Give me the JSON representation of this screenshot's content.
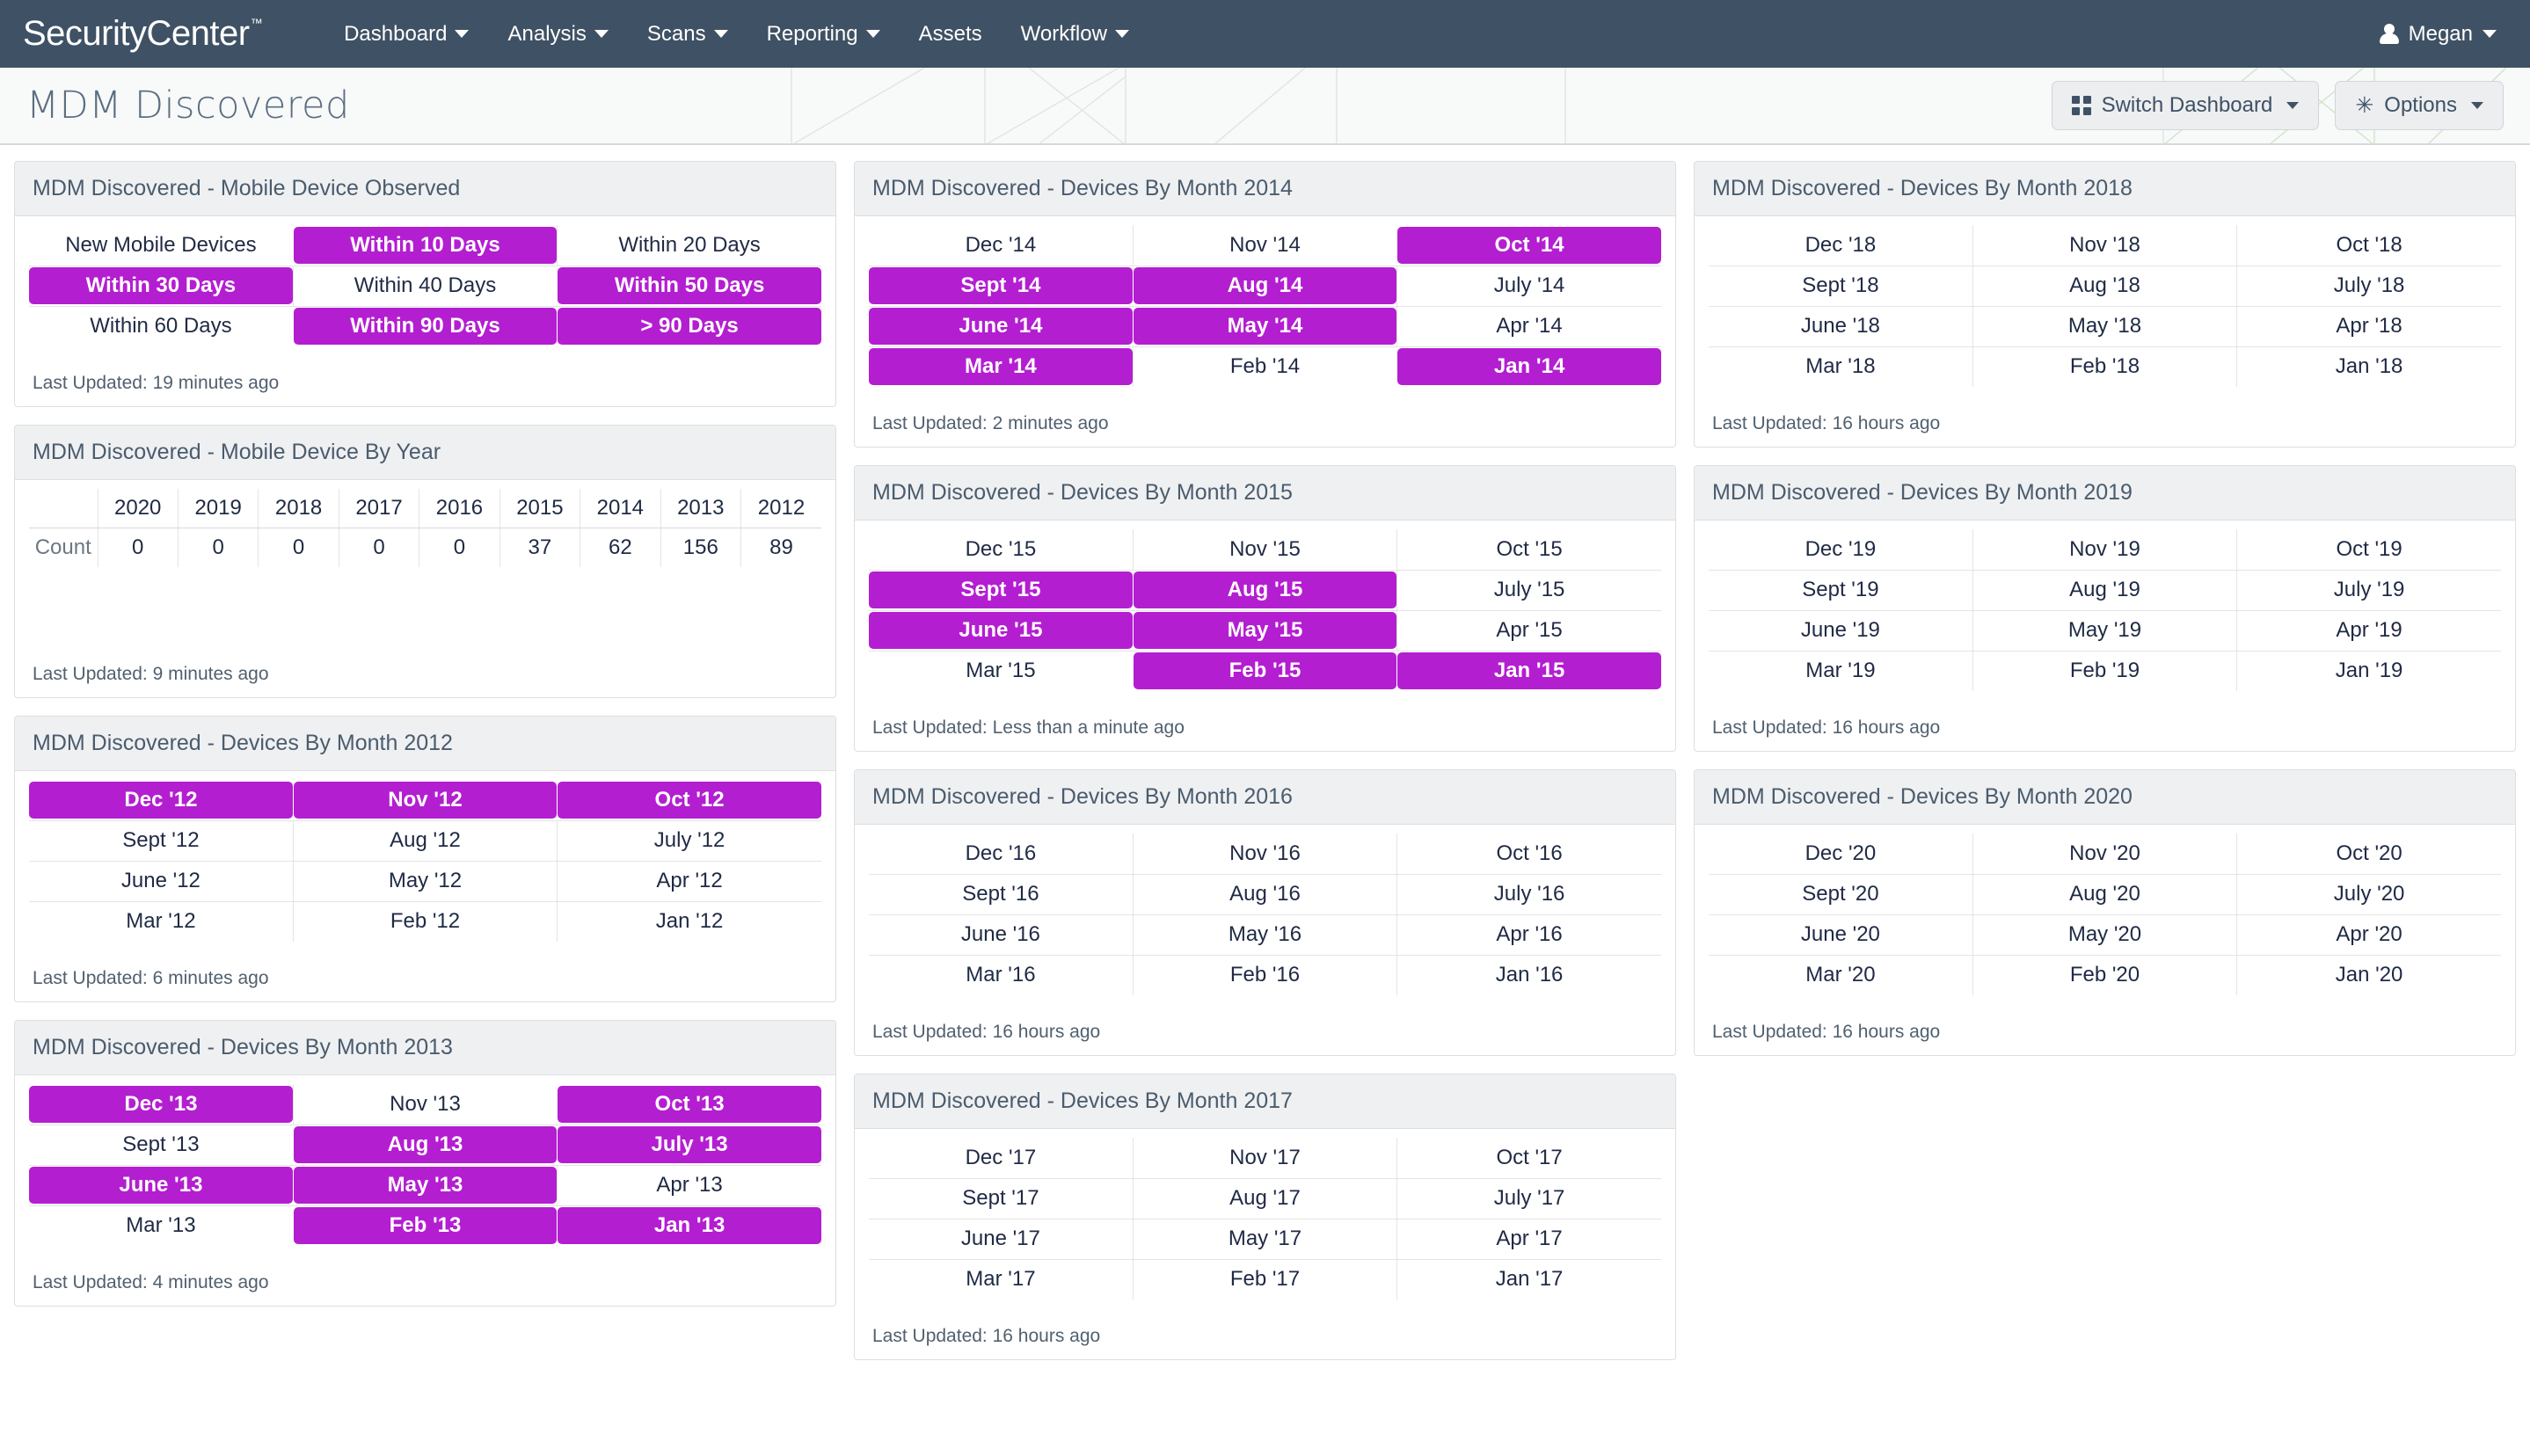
{
  "topnav": {
    "brand": "SecurityCenter",
    "brand_tm": "™",
    "items": [
      {
        "label": "Dashboard",
        "has_caret": true
      },
      {
        "label": "Analysis",
        "has_caret": true
      },
      {
        "label": "Scans",
        "has_caret": true
      },
      {
        "label": "Reporting",
        "has_caret": true
      },
      {
        "label": "Assets",
        "has_caret": false
      },
      {
        "label": "Workflow",
        "has_caret": true
      }
    ],
    "user": "Megan"
  },
  "titlebar": {
    "title": "MDM Discovered",
    "switch_dashboard_label": "Switch Dashboard",
    "options_label": "Options"
  },
  "colors": {
    "highlight": "#b41ed1",
    "navbar": "#3f5164",
    "panel_header": "#eff0f2",
    "text": "#1f2a44"
  },
  "panels": {
    "observed": {
      "title": "MDM Discovered - Mobile Device Observed",
      "rows": [
        [
          {
            "label": "New Mobile Devices",
            "highlighted": false
          },
          {
            "label": "Within 10 Days",
            "highlighted": true
          },
          {
            "label": "Within 20 Days",
            "highlighted": false
          }
        ],
        [
          {
            "label": "Within 30 Days",
            "highlighted": true
          },
          {
            "label": "Within 40 Days",
            "highlighted": false
          },
          {
            "label": "Within 50 Days",
            "highlighted": true
          }
        ],
        [
          {
            "label": "Within 60 Days",
            "highlighted": false
          },
          {
            "label": "Within 90 Days",
            "highlighted": true
          },
          {
            "label": "> 90 Days",
            "highlighted": true
          }
        ]
      ],
      "last_updated": "Last Updated: 19 minutes ago"
    },
    "by_year": {
      "title": "MDM Discovered - Mobile Device By Year",
      "corner_label": "",
      "years": [
        "2020",
        "2019",
        "2018",
        "2017",
        "2016",
        "2015",
        "2014",
        "2013",
        "2012"
      ],
      "row_label": "Count",
      "counts": [
        "0",
        "0",
        "0",
        "0",
        "0",
        "37",
        "62",
        "156",
        "89"
      ],
      "last_updated": "Last Updated: 9 minutes ago"
    },
    "month2012": {
      "title": "MDM Discovered - Devices By Month 2012",
      "rows": [
        [
          {
            "label": "Dec '12",
            "highlighted": true
          },
          {
            "label": "Nov '12",
            "highlighted": true
          },
          {
            "label": "Oct '12",
            "highlighted": true
          }
        ],
        [
          {
            "label": "Sept '12",
            "highlighted": false
          },
          {
            "label": "Aug '12",
            "highlighted": false
          },
          {
            "label": "July '12",
            "highlighted": false
          }
        ],
        [
          {
            "label": "June '12",
            "highlighted": false
          },
          {
            "label": "May '12",
            "highlighted": false
          },
          {
            "label": "Apr '12",
            "highlighted": false
          }
        ],
        [
          {
            "label": "Mar '12",
            "highlighted": false
          },
          {
            "label": "Feb '12",
            "highlighted": false
          },
          {
            "label": "Jan '12",
            "highlighted": false
          }
        ]
      ],
      "last_updated": "Last Updated: 6 minutes ago"
    },
    "month2013": {
      "title": "MDM Discovered - Devices By Month 2013",
      "rows": [
        [
          {
            "label": "Dec '13",
            "highlighted": true
          },
          {
            "label": "Nov '13",
            "highlighted": false
          },
          {
            "label": "Oct '13",
            "highlighted": true
          }
        ],
        [
          {
            "label": "Sept '13",
            "highlighted": false
          },
          {
            "label": "Aug '13",
            "highlighted": true
          },
          {
            "label": "July '13",
            "highlighted": true
          }
        ],
        [
          {
            "label": "June '13",
            "highlighted": true
          },
          {
            "label": "May '13",
            "highlighted": true
          },
          {
            "label": "Apr '13",
            "highlighted": false
          }
        ],
        [
          {
            "label": "Mar '13",
            "highlighted": false
          },
          {
            "label": "Feb '13",
            "highlighted": true
          },
          {
            "label": "Jan '13",
            "highlighted": true
          }
        ]
      ],
      "last_updated": "Last Updated: 4 minutes ago"
    },
    "month2014": {
      "title": "MDM Discovered - Devices By Month 2014",
      "rows": [
        [
          {
            "label": "Dec '14",
            "highlighted": false
          },
          {
            "label": "Nov '14",
            "highlighted": false
          },
          {
            "label": "Oct '14",
            "highlighted": true
          }
        ],
        [
          {
            "label": "Sept '14",
            "highlighted": true
          },
          {
            "label": "Aug '14",
            "highlighted": true
          },
          {
            "label": "July '14",
            "highlighted": false
          }
        ],
        [
          {
            "label": "June '14",
            "highlighted": true
          },
          {
            "label": "May '14",
            "highlighted": true
          },
          {
            "label": "Apr '14",
            "highlighted": false
          }
        ],
        [
          {
            "label": "Mar '14",
            "highlighted": true
          },
          {
            "label": "Feb '14",
            "highlighted": false
          },
          {
            "label": "Jan '14",
            "highlighted": true
          }
        ]
      ],
      "last_updated": "Last Updated: 2 minutes ago"
    },
    "month2015": {
      "title": "MDM Discovered - Devices By Month 2015",
      "rows": [
        [
          {
            "label": "Dec '15",
            "highlighted": false
          },
          {
            "label": "Nov '15",
            "highlighted": false
          },
          {
            "label": "Oct '15",
            "highlighted": false
          }
        ],
        [
          {
            "label": "Sept '15",
            "highlighted": true
          },
          {
            "label": "Aug '15",
            "highlighted": true
          },
          {
            "label": "July '15",
            "highlighted": false
          }
        ],
        [
          {
            "label": "June '15",
            "highlighted": true
          },
          {
            "label": "May '15",
            "highlighted": true
          },
          {
            "label": "Apr '15",
            "highlighted": false
          }
        ],
        [
          {
            "label": "Mar '15",
            "highlighted": false
          },
          {
            "label": "Feb '15",
            "highlighted": true
          },
          {
            "label": "Jan '15",
            "highlighted": true
          }
        ]
      ],
      "last_updated": "Last Updated: Less than a minute ago"
    },
    "month2016": {
      "title": "MDM Discovered - Devices By Month 2016",
      "rows": [
        [
          {
            "label": "Dec '16",
            "highlighted": false
          },
          {
            "label": "Nov '16",
            "highlighted": false
          },
          {
            "label": "Oct '16",
            "highlighted": false
          }
        ],
        [
          {
            "label": "Sept '16",
            "highlighted": false
          },
          {
            "label": "Aug '16",
            "highlighted": false
          },
          {
            "label": "July '16",
            "highlighted": false
          }
        ],
        [
          {
            "label": "June '16",
            "highlighted": false
          },
          {
            "label": "May '16",
            "highlighted": false
          },
          {
            "label": "Apr '16",
            "highlighted": false
          }
        ],
        [
          {
            "label": "Mar '16",
            "highlighted": false
          },
          {
            "label": "Feb '16",
            "highlighted": false
          },
          {
            "label": "Jan '16",
            "highlighted": false
          }
        ]
      ],
      "last_updated": "Last Updated: 16 hours ago"
    },
    "month2017": {
      "title": "MDM Discovered - Devices By Month 2017",
      "rows": [
        [
          {
            "label": "Dec '17",
            "highlighted": false
          },
          {
            "label": "Nov '17",
            "highlighted": false
          },
          {
            "label": "Oct '17",
            "highlighted": false
          }
        ],
        [
          {
            "label": "Sept '17",
            "highlighted": false
          },
          {
            "label": "Aug '17",
            "highlighted": false
          },
          {
            "label": "July '17",
            "highlighted": false
          }
        ],
        [
          {
            "label": "June '17",
            "highlighted": false
          },
          {
            "label": "May '17",
            "highlighted": false
          },
          {
            "label": "Apr '17",
            "highlighted": false
          }
        ],
        [
          {
            "label": "Mar '17",
            "highlighted": false
          },
          {
            "label": "Feb '17",
            "highlighted": false
          },
          {
            "label": "Jan '17",
            "highlighted": false
          }
        ]
      ],
      "last_updated": "Last Updated: 16 hours ago"
    },
    "month2018": {
      "title": "MDM Discovered - Devices By Month 2018",
      "rows": [
        [
          {
            "label": "Dec '18",
            "highlighted": false
          },
          {
            "label": "Nov '18",
            "highlighted": false
          },
          {
            "label": "Oct '18",
            "highlighted": false
          }
        ],
        [
          {
            "label": "Sept '18",
            "highlighted": false
          },
          {
            "label": "Aug '18",
            "highlighted": false
          },
          {
            "label": "July '18",
            "highlighted": false
          }
        ],
        [
          {
            "label": "June '18",
            "highlighted": false
          },
          {
            "label": "May '18",
            "highlighted": false
          },
          {
            "label": "Apr '18",
            "highlighted": false
          }
        ],
        [
          {
            "label": "Mar '18",
            "highlighted": false
          },
          {
            "label": "Feb '18",
            "highlighted": false
          },
          {
            "label": "Jan '18",
            "highlighted": false
          }
        ]
      ],
      "last_updated": "Last Updated: 16 hours ago"
    },
    "month2019": {
      "title": "MDM Discovered - Devices By Month 2019",
      "rows": [
        [
          {
            "label": "Dec '19",
            "highlighted": false
          },
          {
            "label": "Nov '19",
            "highlighted": false
          },
          {
            "label": "Oct '19",
            "highlighted": false
          }
        ],
        [
          {
            "label": "Sept '19",
            "highlighted": false
          },
          {
            "label": "Aug '19",
            "highlighted": false
          },
          {
            "label": "July '19",
            "highlighted": false
          }
        ],
        [
          {
            "label": "June '19",
            "highlighted": false
          },
          {
            "label": "May '19",
            "highlighted": false
          },
          {
            "label": "Apr '19",
            "highlighted": false
          }
        ],
        [
          {
            "label": "Mar '19",
            "highlighted": false
          },
          {
            "label": "Feb '19",
            "highlighted": false
          },
          {
            "label": "Jan '19",
            "highlighted": false
          }
        ]
      ],
      "last_updated": "Last Updated: 16 hours ago"
    },
    "month2020": {
      "title": "MDM Discovered - Devices By Month 2020",
      "rows": [
        [
          {
            "label": "Dec '20",
            "highlighted": false
          },
          {
            "label": "Nov '20",
            "highlighted": false
          },
          {
            "label": "Oct '20",
            "highlighted": false
          }
        ],
        [
          {
            "label": "Sept '20",
            "highlighted": false
          },
          {
            "label": "Aug '20",
            "highlighted": false
          },
          {
            "label": "July '20",
            "highlighted": false
          }
        ],
        [
          {
            "label": "June '20",
            "highlighted": false
          },
          {
            "label": "May '20",
            "highlighted": false
          },
          {
            "label": "Apr '20",
            "highlighted": false
          }
        ],
        [
          {
            "label": "Mar '20",
            "highlighted": false
          },
          {
            "label": "Feb '20",
            "highlighted": false
          },
          {
            "label": "Jan '20",
            "highlighted": false
          }
        ]
      ],
      "last_updated": "Last Updated: 16 hours ago"
    }
  },
  "layout": {
    "col1": [
      "observed",
      "by_year",
      "month2012",
      "month2013"
    ],
    "col2": [
      "month2014",
      "month2015",
      "month2016",
      "month2017"
    ],
    "col3": [
      "month2018",
      "month2019",
      "month2020"
    ]
  }
}
